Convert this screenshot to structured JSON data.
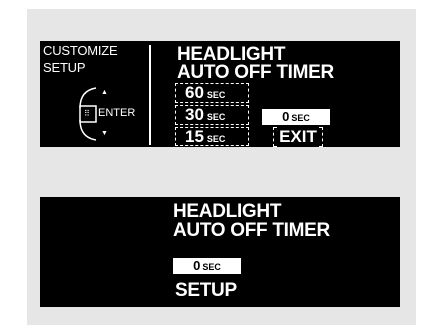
{
  "display1": {
    "left_title_line1": "CUSTOMIZE",
    "left_title_line2": "SETUP",
    "enter_label": "ENTER",
    "up_arrow": "▲",
    "down_arrow": "▼",
    "enter_glyph": "⠿",
    "title_line1": "HEADLIGHT",
    "title_line2": "AUTO OFF TIMER",
    "options": [
      {
        "value": "60",
        "unit": "SEC"
      },
      {
        "value": "30",
        "unit": "SEC"
      },
      {
        "value": "15",
        "unit": "SEC"
      }
    ],
    "selected": {
      "value": "0",
      "unit": "SEC"
    },
    "exit_label": "EXIT"
  },
  "display2": {
    "title_line1": "HEADLIGHT",
    "title_line2": "AUTO OFF TIMER",
    "selected": {
      "value": "0",
      "unit": "SEC"
    },
    "setup_label": "SETUP"
  }
}
